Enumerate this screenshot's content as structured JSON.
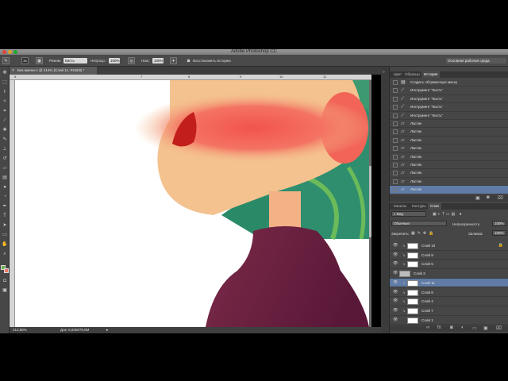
{
  "app": {
    "title": "Adobe Photoshop CC"
  },
  "options_bar": {
    "brush_size": "35",
    "mode_label": "Режим:",
    "mode_value": "Кисть",
    "opacity_label": "Непрозр.:",
    "opacity_value": "100%",
    "flow_label": "Наж.:",
    "flow_value": "100%",
    "restore_history_label": "Восстановить историю",
    "workspace": "Основная рабочая среда"
  },
  "document": {
    "tab_label": "Без имени-1 @ 214% (Слой 11, RGB/8) *",
    "ruler_marks": [
      "6",
      "7",
      "8",
      "9",
      "10",
      "11"
    ],
    "zoom": "213,88%",
    "doc_info": "Док: 5,93M/79,8M"
  },
  "history_panel": {
    "tabs": [
      "Цвет",
      "Образцы",
      "История"
    ],
    "active_tab": "История",
    "items": [
      {
        "label": "Создать обтравочную маску",
        "icon": "layers-icon"
      },
      {
        "label": "Инструмент \"Кисть\"",
        "icon": "brush-icon"
      },
      {
        "label": "Инструмент \"Кисть\"",
        "icon": "brush-icon"
      },
      {
        "label": "Инструмент \"Кисть\"",
        "icon": "brush-icon"
      },
      {
        "label": "Инструмент \"Кисть\"",
        "icon": "brush-icon"
      },
      {
        "label": "Ластик",
        "icon": "eraser-icon"
      },
      {
        "label": "Ластик",
        "icon": "eraser-icon"
      },
      {
        "label": "Ластик",
        "icon": "eraser-icon"
      },
      {
        "label": "Ластик",
        "icon": "eraser-icon"
      },
      {
        "label": "Ластик",
        "icon": "eraser-icon"
      },
      {
        "label": "Ластик",
        "icon": "eraser-icon"
      },
      {
        "label": "Ластик",
        "icon": "eraser-icon"
      },
      {
        "label": "Ластик",
        "icon": "eraser-icon"
      },
      {
        "label": "Ластик",
        "icon": "eraser-icon"
      }
    ]
  },
  "layers_panel": {
    "tabs": [
      "Каналы",
      "Контуры",
      "Слои"
    ],
    "active_tab": "Слои",
    "filter_label": "Вид",
    "blend_mode": "Обычные",
    "opacity_label": "Непрозрачность:",
    "opacity_value": "100%",
    "lock_label": "Закрепить:",
    "fill_label": "Заливка:",
    "fill_value": "100%",
    "layers": [
      {
        "name": "Слой 10",
        "type": "layer",
        "clipped": true,
        "locked": true
      },
      {
        "name": "Слой 9",
        "type": "layer",
        "clipped": true
      },
      {
        "name": "Слой 5",
        "type": "layer",
        "clipped": true
      },
      {
        "name": "Слой 2",
        "type": "group"
      },
      {
        "name": "Слой 11",
        "type": "layer",
        "clipped": true,
        "selected": true
      },
      {
        "name": "Слой 8",
        "type": "layer",
        "clipped": true
      },
      {
        "name": "Слой 4",
        "type": "layer",
        "clipped": true
      },
      {
        "name": "Слой 7",
        "type": "layer",
        "clipped": true
      },
      {
        "name": "Слой 1",
        "type": "layer"
      }
    ]
  },
  "colors": {
    "accent_selection": "#5f7ba6",
    "panel_bg": "#464646",
    "skin": "#f4c28f",
    "blush": "#f0685a",
    "leaves": "#2f8e6e",
    "body": "#6a1f3f"
  }
}
